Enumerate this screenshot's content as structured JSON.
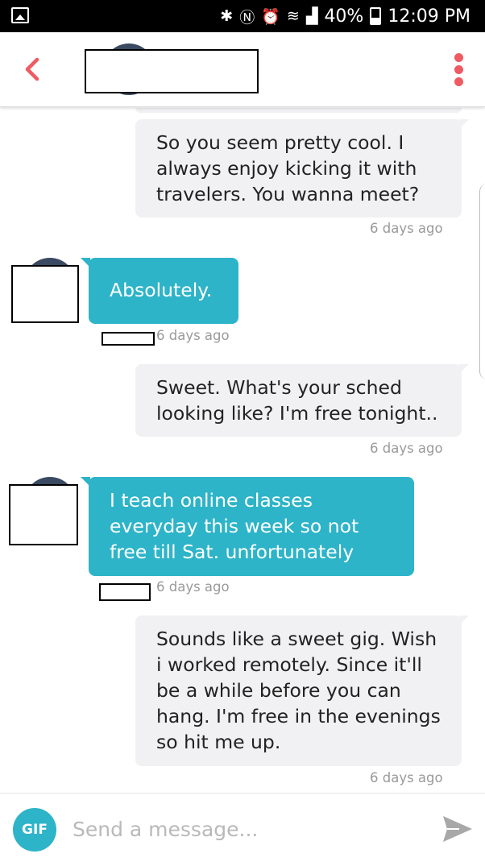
{
  "status_bar": {
    "battery": "40%",
    "time": "12:09 PM",
    "battery_level": 0.4,
    "icons": [
      "image-icon",
      "bluetooth-icon",
      "nfc-icon",
      "alarm-icon",
      "wifi-icon",
      "signal-icon",
      "battery-icon"
    ]
  },
  "header": {
    "back_icon": "chevron-left-icon",
    "menu_icon": "more-vertical-icon",
    "accent_color": "#ef5a63"
  },
  "messages": [
    {
      "side": "sent",
      "text": "So you seem pretty cool. I always enjoy kicking it with travelers. You wanna meet?",
      "time": "6 days ago"
    },
    {
      "side": "received",
      "text": "Absolutely.",
      "time": "6 days ago"
    },
    {
      "side": "sent",
      "text": "Sweet. What's your sched looking like? I'm free tonight..",
      "time": "6 days ago"
    },
    {
      "side": "received",
      "text": "I teach online classes everyday this week so not free till Sat. unfortunately",
      "time": "6 days ago"
    },
    {
      "side": "sent",
      "text": "Sounds like a sweet gig. Wish i worked remotely. Since it'll be a while before you can hang. I'm free in the evenings so hit me up.",
      "time": "6 days ago"
    }
  ],
  "composer": {
    "gif_label": "GIF",
    "placeholder": "Send a message...",
    "send_icon": "send-icon"
  },
  "colors": {
    "received_bubble": "#2db4c8",
    "sent_bubble": "#f1f1f3",
    "timestamp": "#9a9a9a"
  }
}
